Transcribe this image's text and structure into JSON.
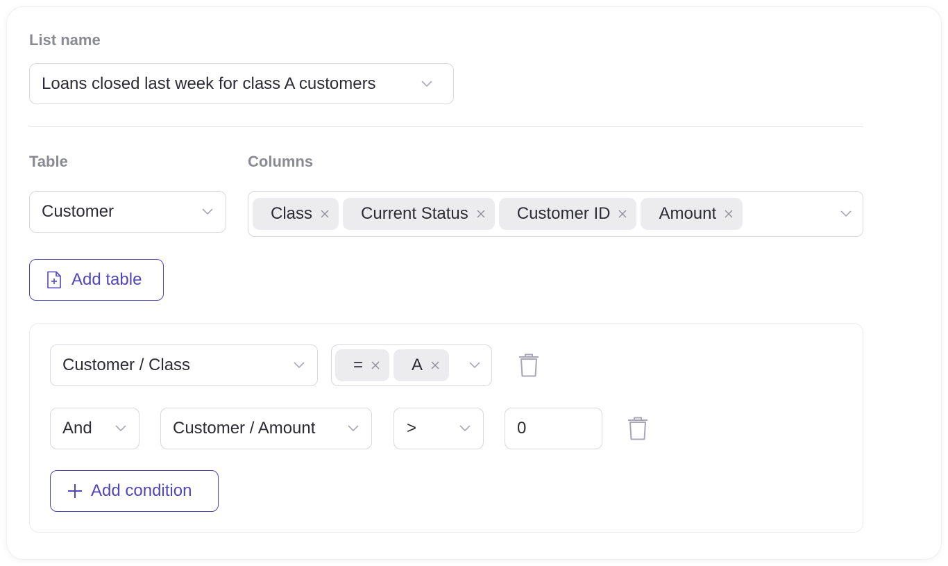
{
  "list_name": {
    "label": "List name",
    "value": "Loans closed last week for class A customers"
  },
  "table_section": {
    "table_label": "Table",
    "columns_label": "Columns",
    "table_value": "Customer",
    "columns": [
      "Class",
      "Current Status",
      "Customer ID",
      "Amount"
    ],
    "add_table_label": "Add table"
  },
  "conditions": {
    "row1": {
      "field": "Customer / Class",
      "operator_chip": "=",
      "value_chip": "A"
    },
    "row2": {
      "connector": "And",
      "field": "Customer / Amount",
      "operator": ">",
      "value": "0"
    },
    "add_condition_label": "Add condition"
  },
  "colors": {
    "accent": "#4f46b8",
    "label_gray": "#8a8a92",
    "border": "#d8d8de",
    "chip_bg": "#ececef",
    "icon_gray": "#a9a6b8"
  },
  "icons": {
    "dropdown": "chevron-down-icon",
    "remove": "close-icon",
    "add_table": "file-plus-icon",
    "delete": "trash-icon",
    "add": "plus-icon"
  }
}
